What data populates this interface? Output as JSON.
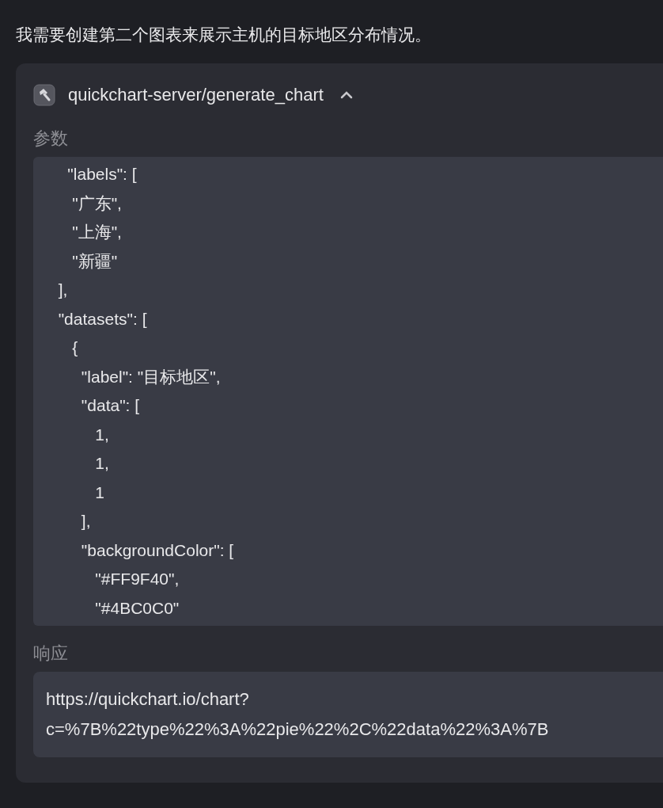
{
  "message": "我需要创建第二个图表来展示主机的目标地区分布情况。",
  "tool_call": {
    "name": "quickchart-server/generate_chart",
    "expanded": true,
    "params_label": "参数",
    "params_lines": [
      "    \"labels\": [",
      "     \"广东\",",
      "     \"上海\",",
      "     \"新疆\"",
      "  ],",
      "  \"datasets\": [",
      "     {",
      "       \"label\": \"目标地区\",",
      "       \"data\": [",
      "          1,",
      "          1,",
      "          1",
      "       ],",
      "       \"backgroundColor\": [",
      "          \"#FF9F40\",",
      "          \"#4BC0C0\""
    ],
    "response_label": "响应",
    "response_lines": [
      "https://quickchart.io/chart?",
      "c=%7B%22type%22%3A%22pie%22%2C%22data%22%3A%7B"
    ]
  }
}
